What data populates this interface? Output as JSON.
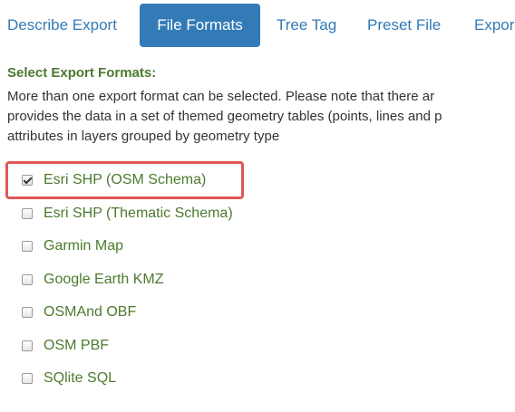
{
  "tabs": [
    {
      "label": "Describe Export",
      "active": false
    },
    {
      "label": "File Formats",
      "active": true
    },
    {
      "label": "Tree Tag",
      "active": false
    },
    {
      "label": "Preset File",
      "active": false
    },
    {
      "label": "Expor",
      "active": false
    }
  ],
  "section": {
    "title": "Select Export Formats:",
    "description_lines": [
      "More than one export format can be selected. Please note that there ar",
      "provides the data in a set of themed geometry tables (points, lines and p",
      "attributes in layers grouped by geometry type"
    ]
  },
  "formats": [
    {
      "label": "Esri SHP (OSM Schema)",
      "checked": true
    },
    {
      "label": "Esri SHP (Thematic Schema)",
      "checked": false
    },
    {
      "label": "Garmin Map",
      "checked": false
    },
    {
      "label": "Google Earth KMZ",
      "checked": false
    },
    {
      "label": "OSMAnd OBF",
      "checked": false
    },
    {
      "label": "OSM PBF",
      "checked": false
    },
    {
      "label": "SQlite SQL",
      "checked": false
    }
  ],
  "colors": {
    "accent": "#337ab7",
    "label_green": "#4c7a2e",
    "highlight_red": "#e05757"
  }
}
